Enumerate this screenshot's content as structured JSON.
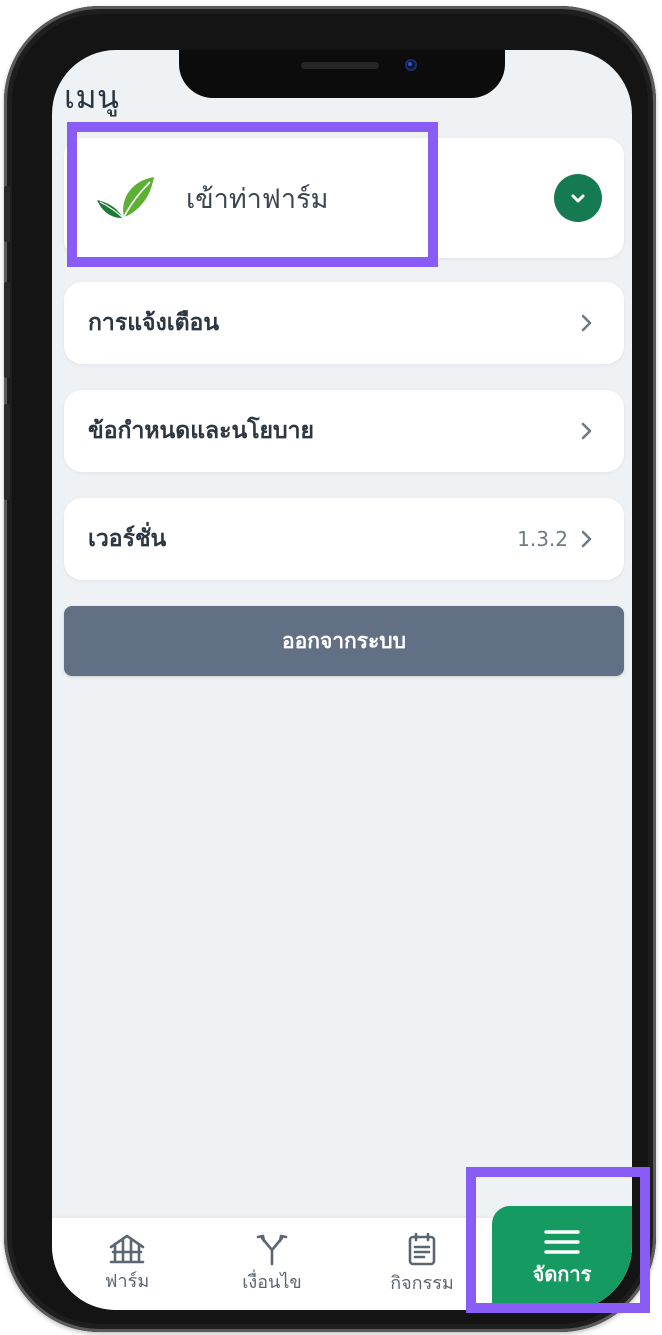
{
  "header": {
    "title": "เมนู"
  },
  "farm_selector": {
    "label": "เข้าท่าฟาร์ม",
    "icon": "leaf-icon",
    "toggle_icon": "chevron-down-icon"
  },
  "menu_items": [
    {
      "label": "การแจ้งเตือน",
      "value": ""
    },
    {
      "label": "ข้อกำหนดและนโยบาย",
      "value": ""
    },
    {
      "label": "เวอร์ชั่น",
      "value": "1.3.2"
    }
  ],
  "logout_button": {
    "label": "ออกจากระบบ"
  },
  "tabbar": {
    "tabs": [
      {
        "label": "ฟาร์ม",
        "icon": "farm-house-icon"
      },
      {
        "label": "เงื่อนไข",
        "icon": "branch-arrows-icon"
      },
      {
        "label": "กิจกรรม",
        "icon": "calendar-list-icon"
      },
      {
        "label": "จัดการ",
        "icon": "hamburger-menu-icon",
        "active": true
      }
    ]
  },
  "colors": {
    "accent_green": "#159a62",
    "toggle_green": "#157a52",
    "logout_gray": "#627085",
    "highlight_purple": "#8a5cf6",
    "screen_bg": "#eef2f5"
  }
}
